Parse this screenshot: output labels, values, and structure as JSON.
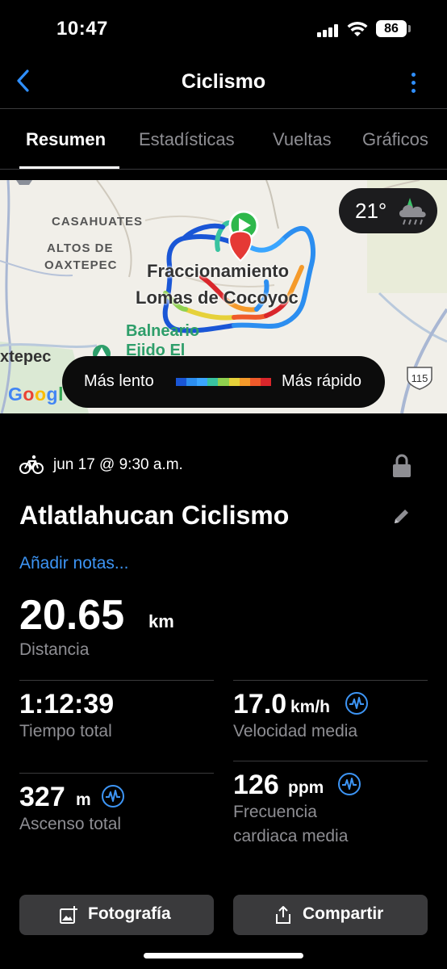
{
  "status_bar": {
    "time": "10:47",
    "battery": "86"
  },
  "nav": {
    "title": "Ciclismo",
    "back_icon": "chevron-left-icon",
    "more_icon": "vertical-ellipsis-icon",
    "accent": "#2f8fff"
  },
  "tabs": [
    {
      "label": "Resumen",
      "active": true
    },
    {
      "label": "Estadísticas",
      "active": false
    },
    {
      "label": "Vueltas",
      "active": false
    },
    {
      "label": "Gráficos",
      "active": false
    }
  ],
  "map": {
    "labels": {
      "casahuates": "CASAHUATES",
      "altos": "ALTOS DE",
      "oaxtepec": "OAXTEPEC",
      "fracc1": "Fraccionamiento",
      "fracc2": "Lomas de Cocoyoc",
      "balneario": "Balneario",
      "ejido": "Ejido El",
      "xtepec": "xtepec",
      "road_shield": "115"
    },
    "weather": {
      "temp": "21°",
      "icon": "cloud-rain-icon"
    },
    "speed_legend": {
      "slow_label": "Más lento",
      "fast_label": "Más rápido",
      "colors": [
        "#1a56d6",
        "#2c8ef0",
        "#3aa6ff",
        "#39c3a0",
        "#8fd14f",
        "#e6d13a",
        "#f59a2a",
        "#ef5a2a",
        "#d9262b"
      ]
    },
    "google_logo": "Google"
  },
  "activity": {
    "icon": "bicycle-icon",
    "date": "jun 17 @ 9:30 a.m.",
    "title": "Atlatlahucan Ciclismo",
    "add_notes": "Añadir notas...",
    "distance": {
      "value": "20.65",
      "unit": "km",
      "label": "Distancia"
    },
    "stats": {
      "total_time": {
        "value": "1:12:39",
        "label": "Tiempo total"
      },
      "avg_speed": {
        "value": "17.0",
        "unit": "km/h",
        "label": "Velocidad media"
      },
      "ascent": {
        "value": "327",
        "unit": "m",
        "label": "Ascenso total"
      },
      "avg_hr": {
        "value": "126",
        "unit": "ppm",
        "label_line1": "Frecuencia",
        "label_line2": "cardiaca media"
      }
    }
  },
  "buttons": {
    "photo": "Fotografía",
    "share": "Compartir"
  }
}
